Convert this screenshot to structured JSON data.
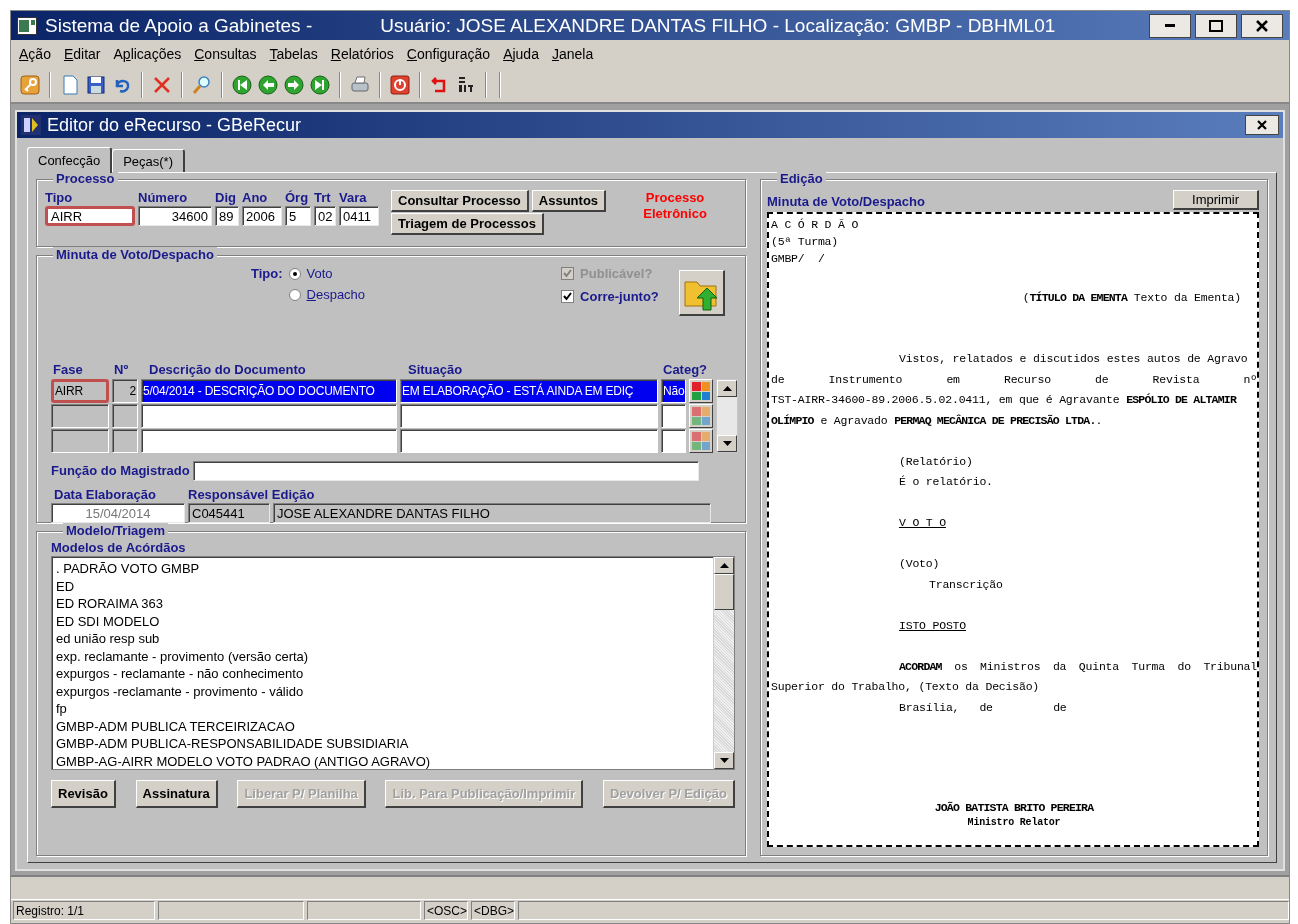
{
  "window": {
    "title": "Sistema de Apoio a Gabinetes -",
    "user_info": "Usuário: JOSE ALEXANDRE DANTAS FILHO - Localização: GMBP - DBHML01"
  },
  "menu": [
    {
      "label": "Ação"
    },
    {
      "label": "Editar"
    },
    {
      "label": "Aplicações"
    },
    {
      "label": "Consultas"
    },
    {
      "label": "Tabelas"
    },
    {
      "label": "Relatórios"
    },
    {
      "label": "Configuração"
    },
    {
      "label": "Ajuda"
    },
    {
      "label": "Janela"
    }
  ],
  "child_window": {
    "title": "Editor do eRecurso - GBeRecur"
  },
  "tabs": [
    {
      "label": "Confecção",
      "selected": true
    },
    {
      "label": "Peças(*)",
      "selected": false
    }
  ],
  "processo": {
    "legend": "Processo",
    "fields": [
      {
        "label": "Tipo",
        "value": "AIRR",
        "kind": "text",
        "highlighted": true
      },
      {
        "label": "Número",
        "value": "34600",
        "kind": "number",
        "highlighted": false
      },
      {
        "label": "Dig",
        "value": "89",
        "kind": "text",
        "highlighted": false
      },
      {
        "label": "Ano",
        "value": "2006",
        "kind": "text",
        "highlighted": false
      },
      {
        "label": "Órg",
        "value": "5",
        "kind": "text",
        "highlighted": false
      },
      {
        "label": "Trt",
        "value": "02",
        "kind": "text",
        "highlighted": false
      },
      {
        "label": "Vara",
        "value": "0411",
        "kind": "text",
        "highlighted": false
      }
    ],
    "buttons": [
      "Consultar Processo",
      "Assuntos",
      "Triagem de Processos"
    ],
    "notice": "Processo Eletrônico"
  },
  "minuta": {
    "legend": "Minuta de Voto/Despacho",
    "tipo_label": "Tipo:",
    "tipo_options": [
      {
        "label": "Voto",
        "selected": true
      },
      {
        "label": "Despacho",
        "selected": false
      }
    ],
    "checks": [
      {
        "label": "Publicável?",
        "checked": true,
        "disabled": true
      },
      {
        "label": "Corre-junto?",
        "checked": true,
        "disabled": false
      }
    ],
    "columns": [
      "Fase",
      "Nº",
      "Descrição do Documento",
      "Situação",
      "Categ?"
    ],
    "rows": [
      {
        "fase": "AIRR",
        "numero": "2",
        "descricao": "5/04/2014 - DESCRIÇÃO DO DOCUMENTO",
        "situacao": "EM ELABORAÇÃO - ESTÁ AINDA EM EDIÇ",
        "categ": "Não",
        "selected": true,
        "highlighted": true
      },
      {
        "selected": false
      },
      {
        "selected": false
      }
    ],
    "funcao_label": "Função do Magistrado",
    "data_label": "Data Elaboração",
    "data_value": "15/04/2014",
    "responsavel_label": "Responsável Edição",
    "responsavel_code": "C045441",
    "responsavel_name": "JOSE ALEXANDRE DANTAS FILHO"
  },
  "modelo": {
    "legend": "Modelo/Triagem",
    "list_label": "Modelos de Acórdãos",
    "items": [
      ". PADRÃO VOTO GMBP",
      "ED",
      "ED RORAIMA 363",
      "ED SDI MODELO",
      "ed união resp sub",
      "exp. reclamante - provimento (versão certa)",
      "expurgos - reclamante - não conhecimento",
      "expurgos -reclamante - provimento - válido",
      "fp",
      "GMBP-ADM PUBLICA TERCEIRIZACAO",
      "GMBP-ADM PUBLICA-RESPONSABILIDADE SUBSIDIARIA",
      "GMBP-AG-AIRR MODELO VOTO PADRAO (ANTIGO AGRAVO)"
    ],
    "buttons": [
      {
        "label": "Revisão",
        "disabled": false
      },
      {
        "label": "Assinatura",
        "disabled": false
      },
      {
        "label": "Liberar P/ Planilha",
        "disabled": true
      },
      {
        "label": "Lib. Para Publicação/Imprimir",
        "disabled": true
      },
      {
        "label": "Devolver P/ Edição",
        "disabled": true
      }
    ]
  },
  "edicao": {
    "legend": "Edição",
    "title": "Minuta de Voto/Despacho",
    "print_button": "Imprimir",
    "document": [
      {
        "kind": "top",
        "text": "A C Ó R D Ã O"
      },
      {
        "kind": "top",
        "text": "(5ª Turma)"
      },
      {
        "kind": "top",
        "text": "GMBP/  /"
      },
      {
        "kind": "blank"
      },
      {
        "kind": "right",
        "text": "(**TÍTULO DA EMENTA** Texto da Ementa)"
      },
      {
        "kind": "blank"
      },
      {
        "kind": "blank"
      },
      {
        "kind": "indent",
        "text": "Vistos, relatados e discutidos estes autos de Agravo"
      },
      {
        "kind": "justify",
        "text": "de Instrumento em Recurso de Revista nº"
      },
      {
        "kind": "plain",
        "text": "TST-AIRR-34600-89.2006.5.02.0411, em que é Agravante **ESPÓLIO DE ALTAMIR**"
      },
      {
        "kind": "plain",
        "text": "**OLÍMPIO** e Agravado **PERMAQ MECÂNICA DE PRECISÃO LTDA.**."
      },
      {
        "kind": "blank"
      },
      {
        "kind": "indent",
        "text": "(Relatório)"
      },
      {
        "kind": "indent",
        "text": "É o relatório."
      },
      {
        "kind": "blank"
      },
      {
        "kind": "heading",
        "text": "V O T O"
      },
      {
        "kind": "blank"
      },
      {
        "kind": "indent",
        "text": "(Voto)"
      },
      {
        "kind": "indent2",
        "text": "Transcrição"
      },
      {
        "kind": "blank"
      },
      {
        "kind": "heading",
        "text": "ISTO POSTO"
      },
      {
        "kind": "blank"
      },
      {
        "kind": "indent_justify",
        "text": "**ACORDAM** os Ministros da Quinta Turma do Tribunal"
      },
      {
        "kind": "plain",
        "text": "Superior do Trabalho, (Texto da Decisão)"
      },
      {
        "kind": "indent",
        "text": "Brasília,   de         de"
      },
      {
        "kind": "blank"
      },
      {
        "kind": "blank"
      },
      {
        "kind": "blank"
      },
      {
        "kind": "blank"
      },
      {
        "kind": "signature",
        "text": "JOÃO BATISTA BRITO PEREIRA"
      },
      {
        "kind": "caption",
        "text": "Ministro Relator"
      }
    ]
  },
  "status_bar": {
    "record": "Registro: 1/1",
    "flags": [
      "<OSC>",
      "<DBG>"
    ]
  }
}
